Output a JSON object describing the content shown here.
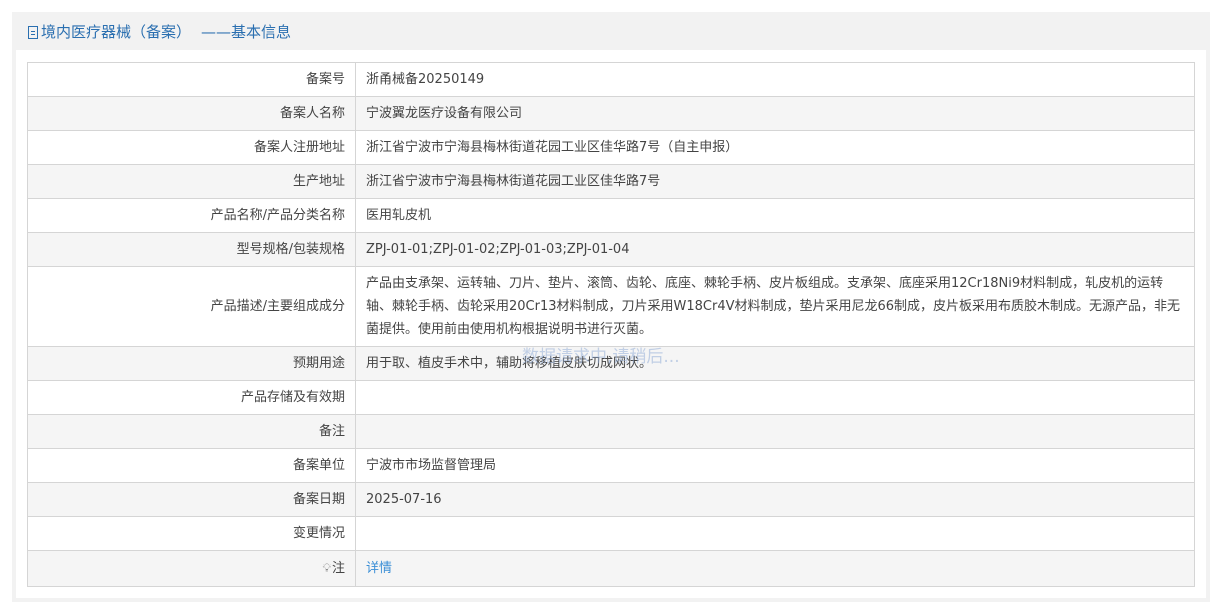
{
  "header": {
    "title": "境内医疗器械（备案）",
    "subtitle": "——基本信息"
  },
  "rows": [
    {
      "label": "备案号",
      "value": "浙甬械备20250149"
    },
    {
      "label": "备案人名称",
      "value": "宁波翼龙医疗设备有限公司"
    },
    {
      "label": "备案人注册地址",
      "value": "浙江省宁波市宁海县梅林街道花园工业区佳华路7号（自主申报）"
    },
    {
      "label": "生产地址",
      "value": "浙江省宁波市宁海县梅林街道花园工业区佳华路7号"
    },
    {
      "label": "产品名称/产品分类名称",
      "value": "医用轧皮机"
    },
    {
      "label": "型号规格/包装规格",
      "value": "ZPJ-01-01;ZPJ-01-02;ZPJ-01-03;ZPJ-01-04"
    },
    {
      "label": "产品描述/主要组成成分",
      "value": "产品由支承架、运转轴、刀片、垫片、滚筒、齿轮、底座、棘轮手柄、皮片板组成。支承架、底座采用12Cr18Ni9材料制成，轧皮机的运转轴、棘轮手柄、齿轮采用20Cr13材料制成，刀片采用W18Cr4V材料制成，垫片采用尼龙66制成，皮片板采用布质胶木制成。无源产品，非无菌提供。使用前由使用机构根据说明书进行灭菌。"
    },
    {
      "label": "预期用途",
      "value": "用于取、植皮手术中，辅助将移植皮肤切成网状。"
    },
    {
      "label": "产品存储及有效期",
      "value": ""
    },
    {
      "label": "备注",
      "value": ""
    },
    {
      "label": "备案单位",
      "value": "宁波市市场监督管理局"
    },
    {
      "label": "备案日期",
      "value": "2025-07-16"
    },
    {
      "label": "变更情况",
      "value": ""
    },
    {
      "label": "注",
      "value": "详情"
    }
  ],
  "overlay_text": "数据请求中,请稍后...",
  "icons": {
    "header": "document-icon",
    "note": "lightbulb-icon"
  }
}
